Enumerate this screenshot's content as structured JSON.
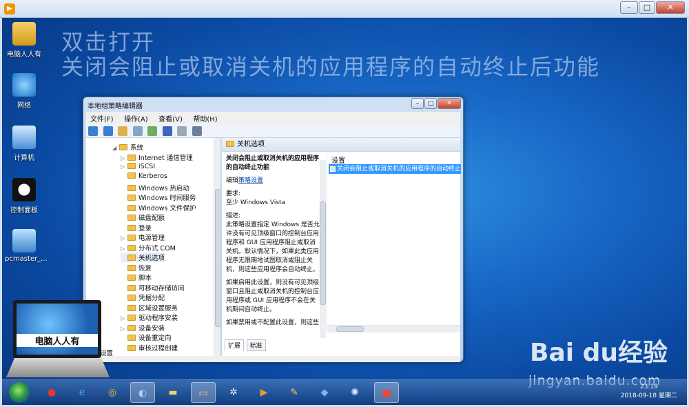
{
  "player": {
    "close_glyph": "✕",
    "max_glyph": "□",
    "min_glyph": "–"
  },
  "headings": {
    "line1": "双击打开",
    "line2": "关闭会阻止或取消关机的应用程序的自动终止后功能"
  },
  "desktop_icons": [
    "电脑人人有",
    "网络",
    "计算机",
    "控制面板",
    "pcmaster_..."
  ],
  "gpedit": {
    "title": "本地组策略编辑器",
    "menus": [
      "文件(F)",
      "操作(A)",
      "查看(V)",
      "帮助(H)"
    ],
    "tree": {
      "root": "系统",
      "items": [
        "Internet 通信管理",
        "iSCSI",
        "Kerberos",
        "Windows 热启动",
        "Windows 时间服务",
        "Windows 文件保护",
        "磁盘配额",
        "登录",
        "电源管理",
        "分布式 COM",
        "关机选项",
        "恢复",
        "脚本",
        "可移动存储访问",
        "凭据分配",
        "区域设置服务",
        "驱动程序安装",
        "设备安装",
        "设备重定向",
        "审核过程创建"
      ],
      "bottom_label": "设置"
    },
    "right_header": "关机选项",
    "description": {
      "title": "关闭会阻止或取消关机的应用程序的自动终止功能",
      "edit_prefix": "编辑",
      "edit_link": "策略设置",
      "requirement_label": "要求:",
      "requirement": "至少 Windows Vista",
      "desc_label": "描述:",
      "desc_p1": "此策略设置指定 Windows 是否允许没有可见顶级窗口的控制台应用程序和 GUI 应用程序阻止或取消关机。默认情况下，如果此类应用程序无限期地试图取消或阻止关机，则这些应用程序会自动终止。",
      "desc_p2": "如果启用此设置，则没有可见顶级窗口且阻止或取消关机的控制台应用程序或 GUI 应用程序不会在关机期间自动终止。",
      "desc_p3": "如果禁用或不配置此设置，则这些"
    },
    "settings_header": "设置",
    "selected_setting": "关闭会阻止或取消关机的应用程序的自动终止",
    "tabs": [
      "扩展",
      "标准"
    ]
  },
  "laptop_text": "电脑人人有",
  "taskbar": {
    "clock_time": "23:19",
    "clock_date": "2018-09-18 星期二"
  },
  "watermark": {
    "brand": "Bai  du经验",
    "url": "jingyan.baidu.com"
  }
}
